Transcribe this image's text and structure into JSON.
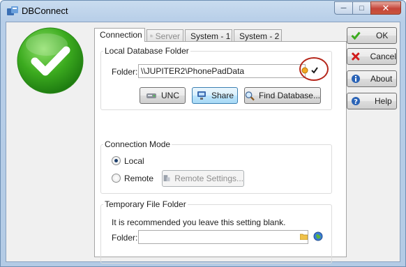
{
  "window": {
    "title": "DBConnect"
  },
  "tabs": [
    {
      "label": "Connection",
      "active": true,
      "enabled": true,
      "icon": "connection-icon"
    },
    {
      "label": "Server",
      "active": false,
      "enabled": false,
      "icon": "server-icon"
    },
    {
      "label": "System - 1",
      "active": false,
      "enabled": true,
      "icon": "system-icon"
    },
    {
      "label": "System - 2",
      "active": false,
      "enabled": true,
      "icon": "system-icon"
    }
  ],
  "local_db": {
    "legend": "Local Database Folder",
    "folder_label": "Folder:",
    "folder_value": "\\\\JUPITER2\\PhonePadData",
    "unc_label": "UNC",
    "share_label": "Share",
    "find_label": "Find Database..."
  },
  "connection_mode": {
    "legend": "Connection Mode",
    "local_label": "Local",
    "remote_label": "Remote",
    "selected": "Local",
    "remote_settings_label": "Remote Settings..."
  },
  "temp_folder": {
    "legend": "Temporary File Folder",
    "note": "It is recommended you leave this setting blank.",
    "folder_label": "Folder:",
    "folder_value": ""
  },
  "side_buttons": {
    "ok": "OK",
    "cancel": "Cancel",
    "about": "About",
    "help": "Help"
  },
  "colors": {
    "status_green": "#3cab1f",
    "cancel_red": "#d11a1a",
    "info_blue": "#2a63b6",
    "highlight_ring": "#b5261b"
  }
}
